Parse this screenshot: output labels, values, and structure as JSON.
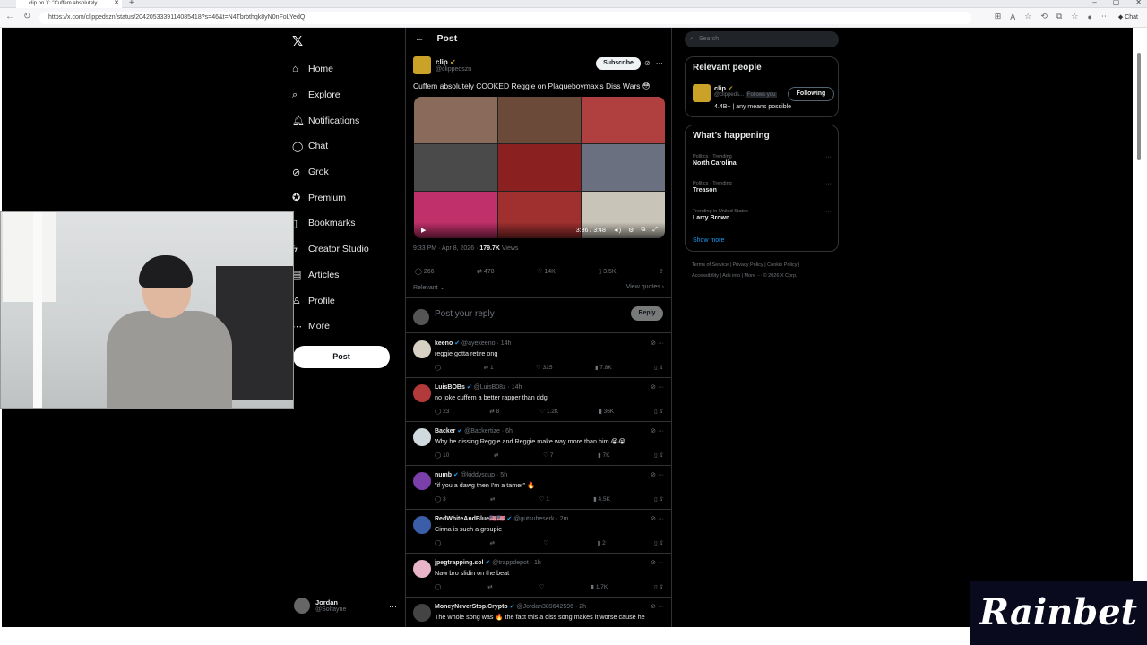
{
  "browser": {
    "tab_title": "clip on X: \"Cuffem absolutely...",
    "url": "https://x.com/clippedszn/status/2042053339114085418?s=46&t=N4Tbrbthqk8yN0nFoLYedQ",
    "copilot_label": "Chat"
  },
  "nav": {
    "items": [
      {
        "label": "Home",
        "icon": "home-icon"
      },
      {
        "label": "Explore",
        "icon": "search-icon"
      },
      {
        "label": "Notifications",
        "icon": "bell-icon"
      },
      {
        "label": "Chat",
        "icon": "chat-icon"
      },
      {
        "label": "Grok",
        "icon": "grok-icon"
      },
      {
        "label": "Premium",
        "icon": "premium-icon"
      },
      {
        "label": "Bookmarks",
        "icon": "bookmark-icon"
      },
      {
        "label": "Creator Studio",
        "icon": "lightning-icon"
      },
      {
        "label": "Articles",
        "icon": "article-icon"
      },
      {
        "label": "Profile",
        "icon": "person-icon"
      },
      {
        "label": "More",
        "icon": "more-icon"
      }
    ],
    "post_button": "Post"
  },
  "account": {
    "name": "Jordan",
    "handle": "@Solfayne"
  },
  "header": {
    "title": "Post"
  },
  "post": {
    "author_name": "clip",
    "author_handle": "@clippedszn",
    "subscribe_label": "Subscribe",
    "text": "Cuffem absolutely COOKED Reggie on Plaqueboymax's Diss Wars 😳",
    "video_time": "3:36 / 3:48",
    "timestamp": "9:33 PM · Apr 8, 2026 ·",
    "views": "179.7K",
    "views_label": "Views",
    "replies": "266",
    "reposts": "478",
    "likes": "14K",
    "bookmarks": "3.5K",
    "sort_label": "Relevant",
    "view_quotes": "View quotes"
  },
  "reply_box": {
    "placeholder": "Post your reply",
    "button": "Reply"
  },
  "replies": [
    {
      "name": "keeno",
      "handle": "@ayekeeno · 14h",
      "text": "reggie gotta retire ong",
      "replies": "",
      "reposts": "1",
      "likes": "325",
      "views": "7.8K",
      "avatar_color": "#d7d1c4"
    },
    {
      "name": "LuisBOBs",
      "handle": "@LuisB08z · 14h",
      "text": "no joke cuffem a better rapper than ddg",
      "replies": "23",
      "reposts": "8",
      "likes": "1.2K",
      "views": "36K",
      "avatar_color": "#b33a3a"
    },
    {
      "name": "Backer",
      "handle": "@Backertize · 6h",
      "text": "Why he dissing Reggie and Reggie make way more than him 😭😭",
      "replies": "10",
      "reposts": "",
      "likes": "7",
      "views": "7K",
      "avatar_color": "#cfd9de"
    },
    {
      "name": "numb",
      "handle": "@kiddvscup · 5h",
      "text": "\"if you a dawg then I'm a tamer\" 🔥",
      "replies": "3",
      "reposts": "",
      "likes": "1",
      "views": "4.5K",
      "avatar_color": "#7a3fa8"
    },
    {
      "name": "RedWhiteAndBlue🇺🇸🇺🇸",
      "handle": "@gutsubeserk · 2m",
      "text": "Cinna is such a groupie",
      "replies": "",
      "reposts": "",
      "likes": "",
      "views": "2",
      "avatar_color": "#3a5fa8"
    },
    {
      "name": "jpegtrapping.sol",
      "handle": "@trappdepot · 1h",
      "text": "Naw bro slidin on the beat",
      "replies": "",
      "reposts": "",
      "likes": "",
      "views": "1.7K",
      "avatar_color": "#e8b4c8"
    },
    {
      "name": "MoneyNeverStop.Crypto",
      "handle": "@Jordan389642596 · 2h",
      "text": "The whole song was 🔥 the fact this a diss song makes it worse cause he",
      "replies": "",
      "reposts": "",
      "likes": "",
      "views": "",
      "avatar_color": "#444"
    }
  ],
  "right": {
    "search_placeholder": "Search",
    "relevant_title": "Relevant people",
    "rel_name": "clip",
    "rel_handle": "@clippeds...",
    "rel_follows": "Follows you",
    "rel_bio": "4.4B+ | any means possible",
    "follow_button": "Following",
    "happening_title": "What’s happening",
    "trends": [
      {
        "context": "Politics · Trending",
        "title": "North Carolina"
      },
      {
        "context": "Politics · Trending",
        "title": "Treason"
      },
      {
        "context": "Trending in United States",
        "title": "Larry Brown"
      }
    ],
    "show_more": "Show more",
    "footer_line1": "Terms of Service  |  Privacy Policy  |  Cookie Policy  |",
    "footer_line2": "Accessibility  |  Ads info  |  More ···  © 2026 X Corp."
  },
  "overlay": {
    "brand": "Rainbet"
  },
  "colors": {
    "accent": "#1d9bf0",
    "background": "#000000",
    "verified": "#1d9bf0",
    "gold": "#c9a227"
  }
}
